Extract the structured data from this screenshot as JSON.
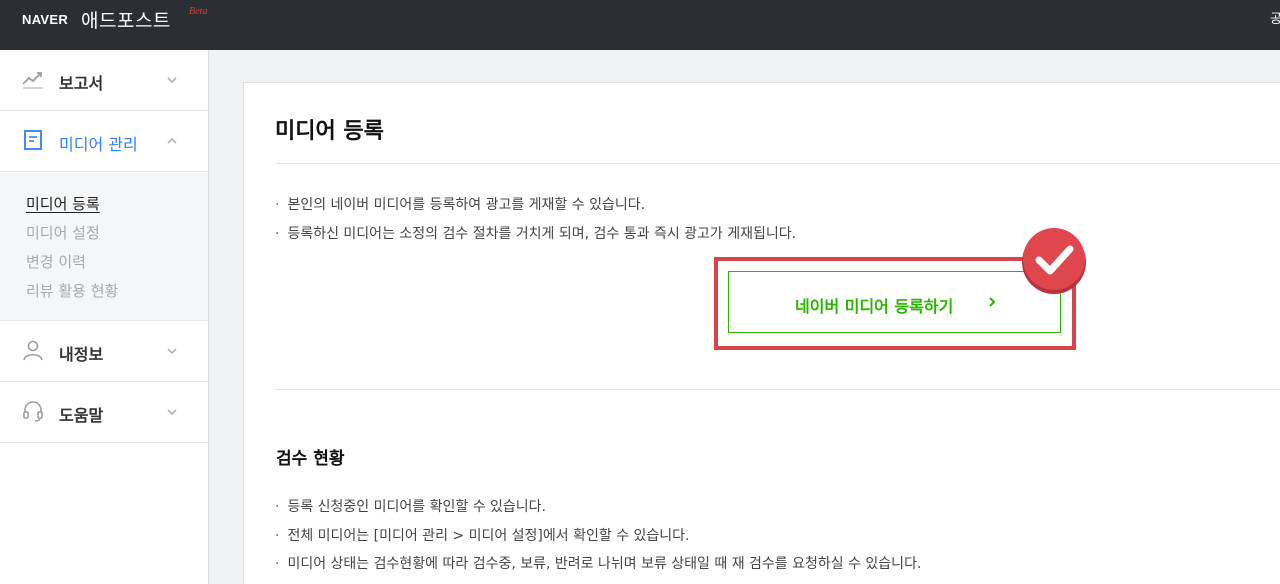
{
  "header": {
    "brand": "NAVER",
    "product": "애드포스트",
    "beta": "Beta",
    "user_partial": "공"
  },
  "sidebar": {
    "items": [
      {
        "label": "보고서",
        "icon": "chart-line-icon",
        "state": "collapsed"
      },
      {
        "label": "미디어 관리",
        "icon": "document-icon",
        "state": "expanded"
      },
      {
        "label": "내정보",
        "icon": "person-icon",
        "state": "collapsed"
      },
      {
        "label": "도움말",
        "icon": "headset-icon",
        "state": "collapsed"
      }
    ],
    "submenu": [
      {
        "label": "미디어 등록",
        "current": true
      },
      {
        "label": "미디어 설정",
        "current": false
      },
      {
        "label": "변경 이력",
        "current": false
      },
      {
        "label": "리뷰 활용 현황",
        "current": false
      }
    ]
  },
  "main": {
    "title": "미디어 등록",
    "intro_notes": [
      "본인의 네이버 미디어를 등록하여 광고를 게재할 수 있습니다.",
      "등록하신 미디어는 소정의 검수 절차를 거치게 되며, 검수 통과 즉시 광고가 게재됩니다."
    ],
    "register_button": "네이버 미디어 등록하기",
    "review_section": {
      "title": "검수 현황",
      "notes": [
        "등록 신청중인 미디어를 확인할 수 있습니다.",
        "전체 미디어는 [미디어 관리 > 미디어 설정]에서 확인할 수 있습니다.",
        "미디어 상태는 검수현황에 따라 검수중, 보류, 반려로 나뉘며 보류 상태일 때 재 검수를 요청하실 수 있습니다."
      ]
    }
  },
  "colors": {
    "topbar": "#2b2e33",
    "accent_blue": "#2f80ed",
    "naver_green": "#2db400",
    "highlight_red": "#d9434a"
  }
}
